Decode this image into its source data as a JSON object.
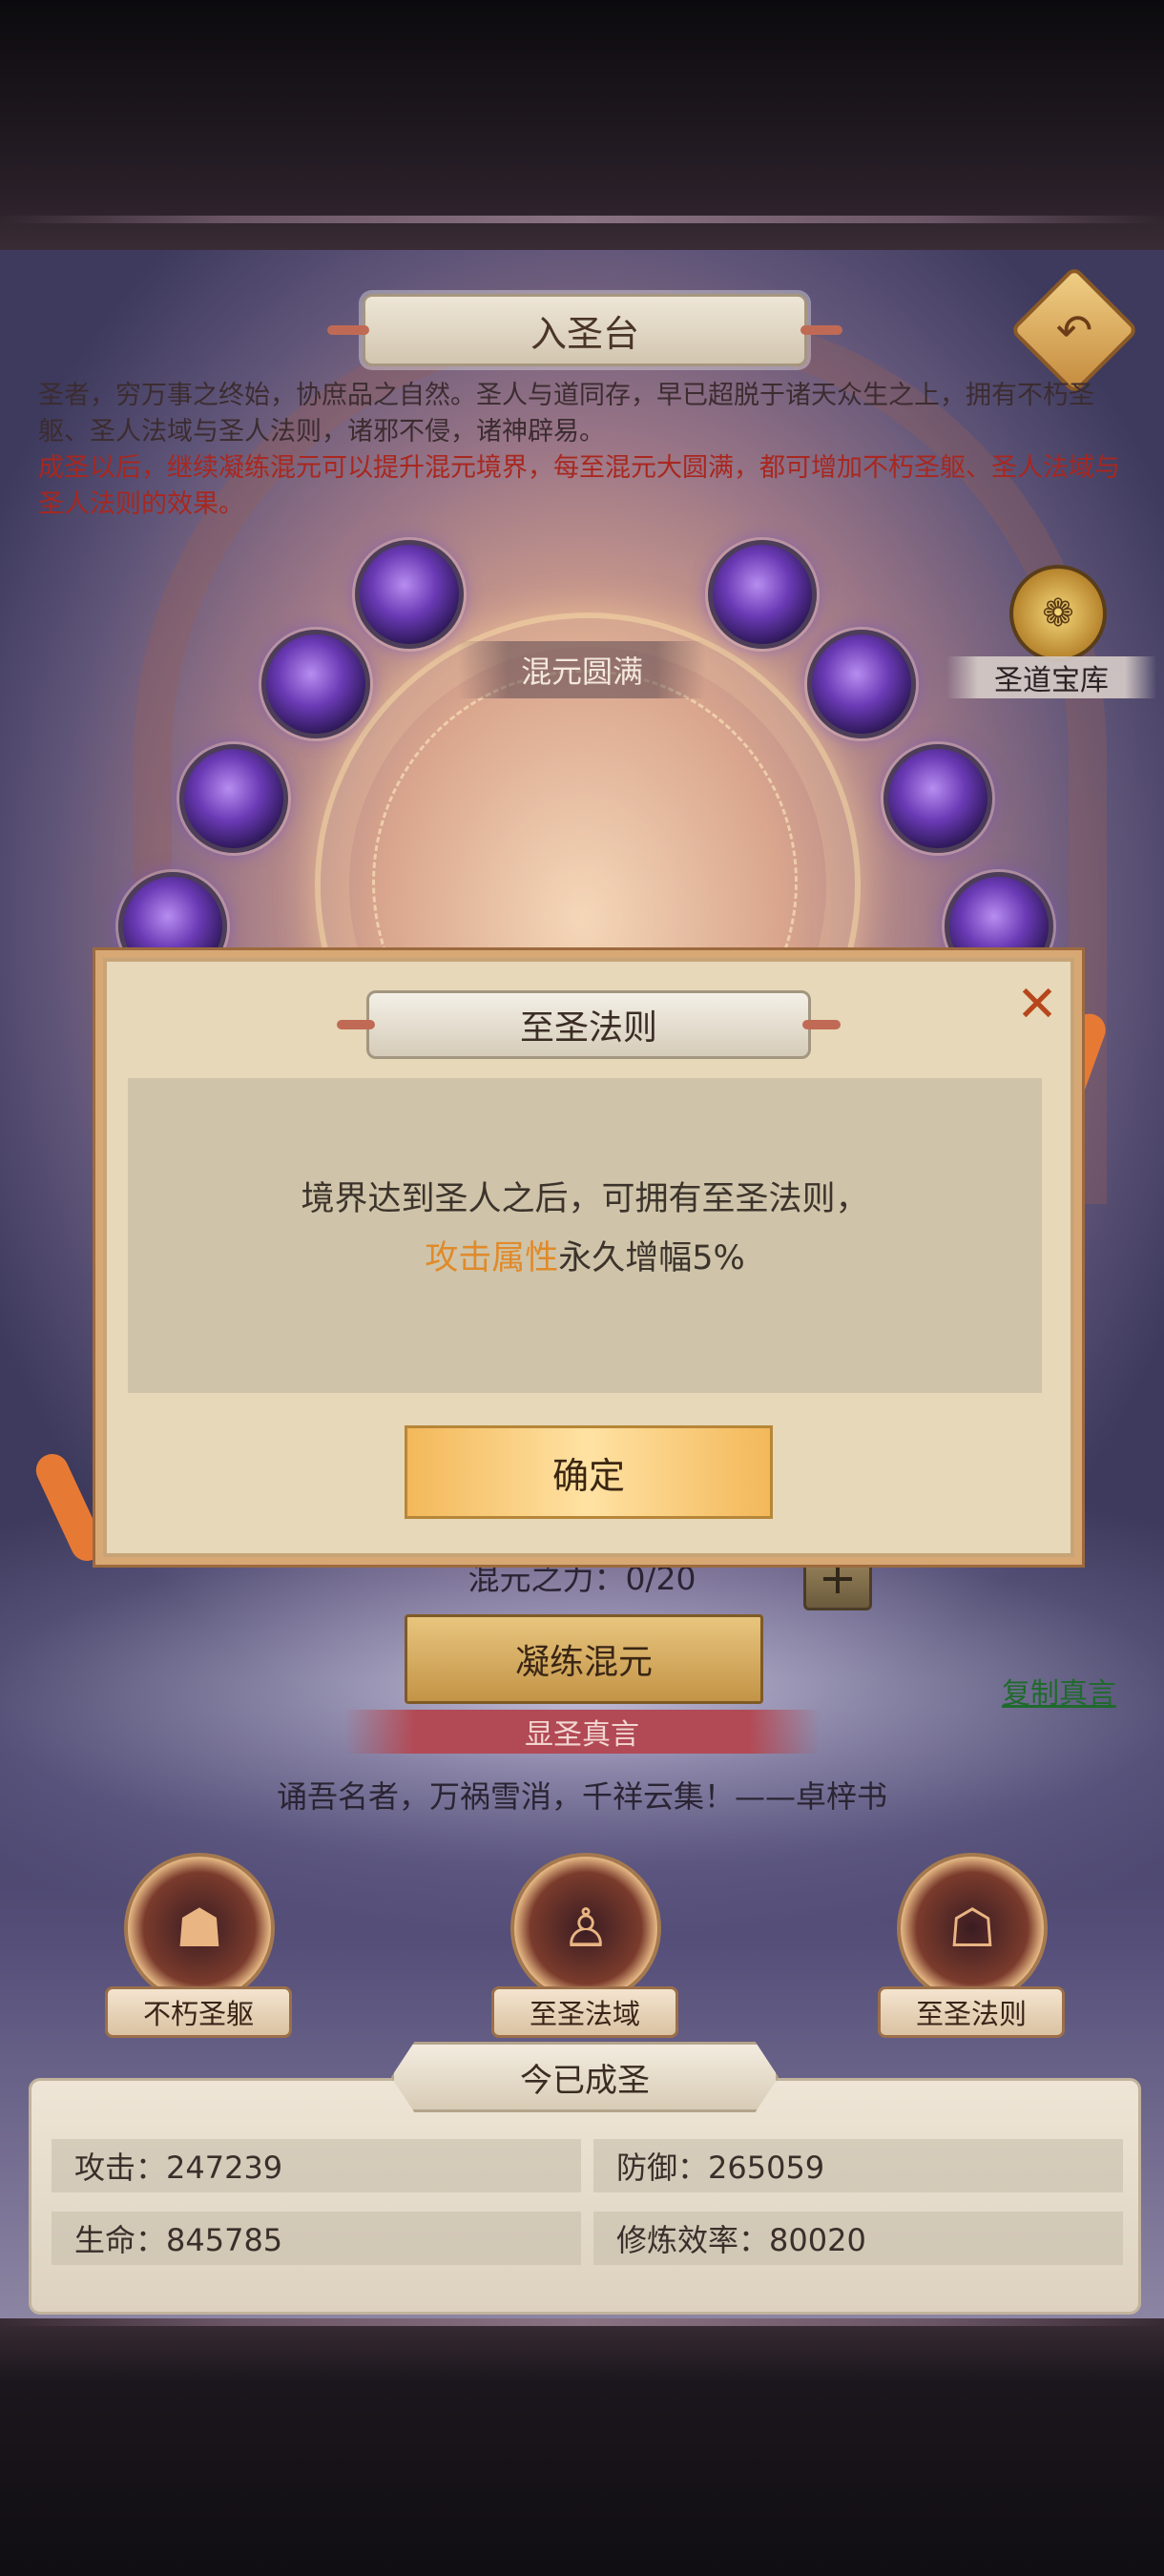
{
  "header": {
    "title": "入圣台",
    "back_icon": "↶"
  },
  "description": {
    "line_main": "圣者，穷万事之终始，协庶品之自然。圣人与道同存，早已超脱于诸天众生之上，拥有不朽圣躯、圣人法域与圣人法则，诸邪不侵，诸神辟易。",
    "line_red": "成圣以后，继续凝练混元可以提升混元境界，每至混元大圆满，都可增加不朽圣躯、圣人法域与圣人法则的效果。"
  },
  "realm": {
    "label": "混元圆满"
  },
  "treasury": {
    "label": "圣道宝库",
    "icon": "❁"
  },
  "power": {
    "text": "混元之力：0/20",
    "plus": "+",
    "refine_label": "凝练混元"
  },
  "copy_link": "复制真言",
  "mantra": {
    "banner": "显圣真言",
    "text": "诵吾名者，万祸雪消，千祥云集！——卓梓书"
  },
  "skills": [
    {
      "label": "不朽圣躯",
      "icon": "☗"
    },
    {
      "label": "至圣法域",
      "icon": "♙"
    },
    {
      "label": "至圣法则",
      "icon": "☖"
    }
  ],
  "stats": {
    "title": "今已成圣",
    "attack": "攻击：247239",
    "defense": "防御：265059",
    "life": "生命：845785",
    "efficiency": "修炼效率：80020"
  },
  "modal": {
    "title": "至圣法则",
    "close": "✕",
    "line1": "境界达到圣人之后，可拥有至圣法则，",
    "highlight": "攻击属性",
    "line2_rest": "永久增幅5%",
    "ok_label": "确定",
    "highlight_color": "#e08a2a"
  }
}
